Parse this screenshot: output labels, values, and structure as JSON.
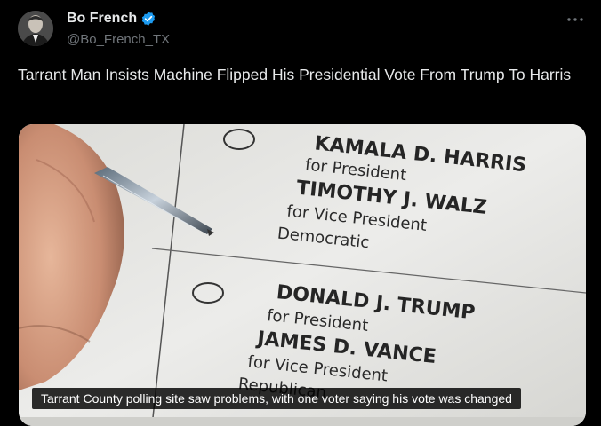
{
  "author": {
    "display_name": "Bo French",
    "handle": "@Bo_French_TX",
    "verified_color": "#1d9bf0"
  },
  "tweet": {
    "text": "Tarrant Man Insists Machine Flipped His Presidential Vote From Trump To Harris"
  },
  "media": {
    "caption": "Tarrant County polling site saw problems, with one voter saying his vote was changed",
    "ballot": {
      "candidate1_name": "KAMALA D. HARRIS",
      "candidate1_role": "for President",
      "running_mate1_name": "TIMOTHY J. WALZ",
      "running_mate1_role": "for Vice President",
      "party1": "Democratic",
      "candidate2_name": "DONALD J. TRUMP",
      "candidate2_role": "for President",
      "running_mate2_name": "JAMES D. VANCE",
      "running_mate2_role": "for Vice President",
      "party2": "Republican"
    }
  },
  "icons": {
    "verified": "verified-badge-icon",
    "more": "more-options-icon"
  }
}
